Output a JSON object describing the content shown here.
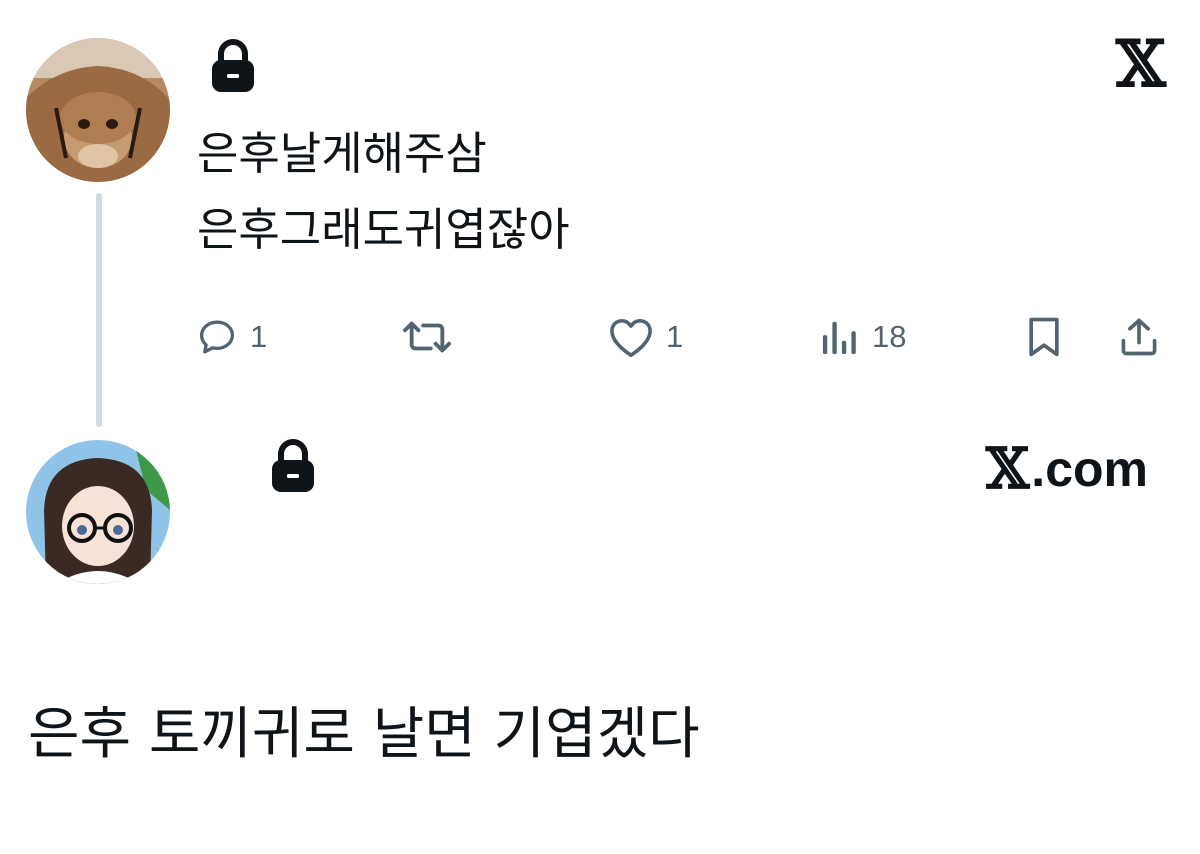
{
  "tweet": {
    "avatar_icon": "rabbit-avatar",
    "lock_icon": "lock-icon",
    "platform_logo": "𝕏",
    "lines": [
      "은후날게해주삼",
      "은후그래도귀엽잖아"
    ],
    "actions": {
      "reply": {
        "icon": "reply-icon",
        "count": "1"
      },
      "retweet": {
        "icon": "retweet-icon",
        "count": ""
      },
      "like": {
        "icon": "heart-icon",
        "count": "1"
      },
      "views": {
        "icon": "views-icon",
        "count": "18"
      },
      "bookmark": {
        "icon": "bookmark-icon"
      },
      "share": {
        "icon": "share-icon"
      }
    }
  },
  "reply": {
    "avatar_icon": "anime-girl-avatar",
    "lock_icon": "lock-icon",
    "domain_logo": "𝕏",
    "domain_text": ".com"
  },
  "caption": "은후 토끼귀로 날면 기엽겠다",
  "colors": {
    "text": "#0f1419",
    "muted": "#536471",
    "thread_line": "#cfd9de"
  }
}
